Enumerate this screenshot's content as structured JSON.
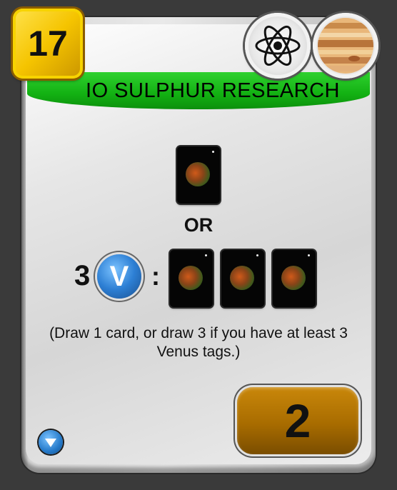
{
  "card": {
    "cost": "17",
    "title": "IO SULPHUR RESEARCH",
    "tags": [
      "science-tag-icon",
      "jovian-tag-icon"
    ],
    "or_label": "OR",
    "requirement_count": "3",
    "requirement_tag_letter": "V",
    "colon": ":",
    "description": "(Draw 1 card, or draw 3 if you have at least 3 Venus tags.)",
    "victory_points": "2"
  },
  "colors": {
    "title_banner": "#12b012",
    "cost_badge": "#f5c400",
    "vp_box": "#a86c00",
    "venus_tag": "#2d7fd4"
  }
}
